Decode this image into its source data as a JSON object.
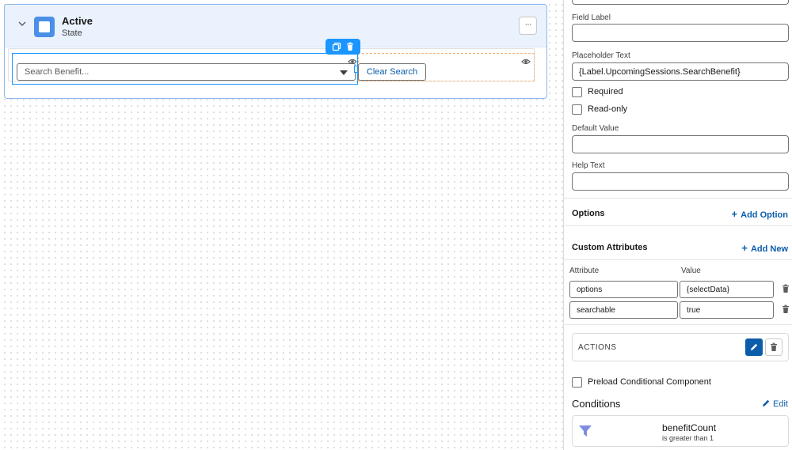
{
  "canvas": {
    "state": {
      "title": "Active",
      "subtitle": "State"
    },
    "combobox": {
      "placeholder": "Search Benefit..."
    },
    "clear_button_label": "Clear Search",
    "more_button_label": "···"
  },
  "panel": {
    "field_label_label": "Field Label",
    "field_label_value": "",
    "placeholder_label": "Placeholder Text",
    "placeholder_value": "{Label.UpcomingSessions.SearchBenefit}",
    "required_label": "Required",
    "readonly_label": "Read-only",
    "default_value_label": "Default Value",
    "default_value_value": "",
    "help_text_label": "Help Text",
    "help_text_value": "",
    "options_title": "Options",
    "add_option_label": "Add Option",
    "custom_attributes_title": "Custom Attributes",
    "add_new_label": "Add New",
    "attribute_header": "Attribute",
    "value_header": "Value",
    "attributes": [
      {
        "name": "options",
        "value": "{selectData}"
      },
      {
        "name": "searchable",
        "value": "true"
      }
    ],
    "actions_label": "ACTIONS",
    "preload_label": "Preload Conditional Component",
    "conditions_title": "Conditions",
    "conditions_edit_label": "Edit",
    "condition": {
      "field": "benefitCount",
      "rule": "is greater than 1"
    }
  },
  "colors": {
    "accent": "#0b5cab",
    "selection": "#1b96ff",
    "state_header_bg": "#eaf2fd",
    "state_icon": "#4a90e8",
    "filter_icon": "#7f8de1",
    "slot_outline": "#f3b27a"
  }
}
